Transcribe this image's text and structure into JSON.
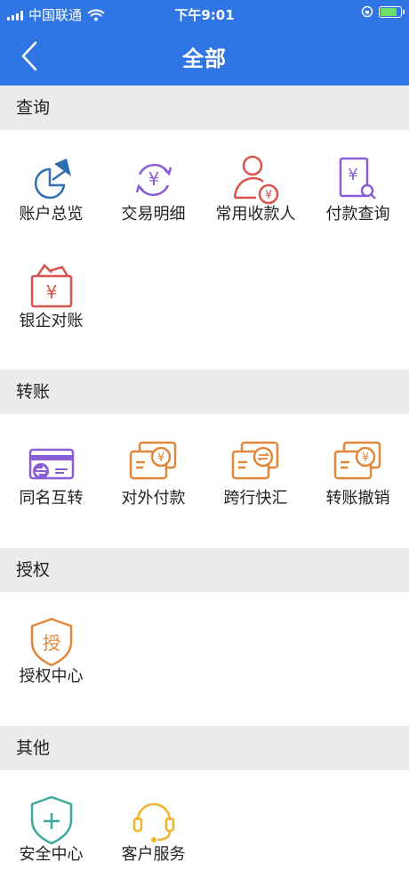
{
  "status_bar": {
    "carrier": "中国联通",
    "time": "下午9:01"
  },
  "header": {
    "title": "全部"
  },
  "sections": [
    {
      "title": "查询",
      "items": [
        {
          "label": "账户总览",
          "icon": "pie-chart-icon"
        },
        {
          "label": "交易明细",
          "icon": "yen-cycle-icon"
        },
        {
          "label": "常用收款人",
          "icon": "payee-icon"
        },
        {
          "label": "付款查询",
          "icon": "yen-search-icon"
        },
        {
          "label": "银企对账",
          "icon": "yen-envelope-icon"
        }
      ]
    },
    {
      "title": "转账",
      "items": [
        {
          "label": "同名互转",
          "icon": "card-exchange-icon"
        },
        {
          "label": "对外付款",
          "icon": "card-yen-icon"
        },
        {
          "label": "跨行快汇",
          "icon": "card-transfer-icon"
        },
        {
          "label": "转账撤销",
          "icon": "card-yen-cancel-icon"
        }
      ]
    },
    {
      "title": "授权",
      "items": [
        {
          "label": "授权中心",
          "icon": "authorize-shield-icon",
          "glyph": "授"
        }
      ]
    },
    {
      "title": "其他",
      "items": [
        {
          "label": "安全中心",
          "icon": "security-shield-icon"
        },
        {
          "label": "客户服务",
          "icon": "headset-icon"
        }
      ]
    }
  ],
  "colors": {
    "header_bg": "#2f75e3",
    "section_bg": "#ebebeb",
    "blue": "#2d6fb0",
    "purple": "#8a5cd6",
    "red": "#d9534f",
    "orange": "#e0873a",
    "teal": "#3aa89a",
    "yellow": "#f0b429"
  }
}
